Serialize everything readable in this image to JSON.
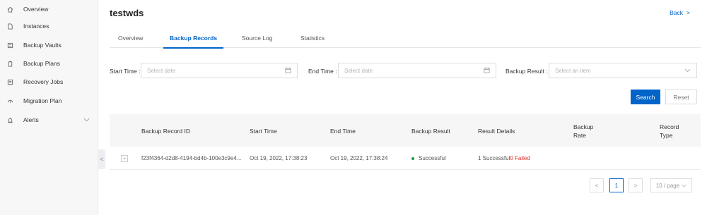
{
  "sidebar": {
    "items": [
      {
        "label": "Overview",
        "icon": "home-icon"
      },
      {
        "label": "Instances",
        "icon": "document-icon"
      },
      {
        "label": "Backup Vaults",
        "icon": "vault-icon"
      },
      {
        "label": "Backup Plans",
        "icon": "clipboard-icon"
      },
      {
        "label": "Recovery Jobs",
        "icon": "list-icon"
      },
      {
        "label": "Migration Plan",
        "icon": "cloud-icon"
      },
      {
        "label": "Alerts",
        "icon": "alarm-icon"
      }
    ],
    "collapse_glyph": "<"
  },
  "header": {
    "title": "testwds",
    "back_label": "Back",
    "back_glyph": ">"
  },
  "tabs": [
    {
      "label": "Overview",
      "active": false
    },
    {
      "label": "Backup Records",
      "active": true
    },
    {
      "label": "Source Log",
      "active": false
    },
    {
      "label": "Statistics",
      "active": false
    }
  ],
  "filters": {
    "start_time_label": "Start Time :",
    "start_time_placeholder": "Select date",
    "end_time_label": "End Time :",
    "end_time_placeholder": "Select date",
    "backup_result_label": "Backup Result :",
    "backup_result_placeholder": "Select an item",
    "search_label": "Search",
    "reset_label": "Reset"
  },
  "table": {
    "columns": [
      "Backup Record ID",
      "Start Time",
      "End Time",
      "Backup Result",
      "Result Details",
      "Backup Rate",
      "Record Type"
    ],
    "rows": [
      {
        "expand": "+",
        "id": "f23f4364-d2d8-4194-bd4b-100e3c9e4...",
        "start_time": "Oct 19, 2022, 17:38:23",
        "end_time": "Oct 19, 2022, 17:38:24",
        "result": "Successful",
        "details_success": "1 Successful",
        "details_failed": "0 Failed",
        "rate": "",
        "type": ""
      }
    ]
  },
  "pagination": {
    "prev": "<",
    "current_page": "1",
    "next": ">",
    "page_size": "10 / page"
  },
  "colors": {
    "accent": "#0064c8",
    "success": "#1e9e3e",
    "failed": "#d93026"
  }
}
